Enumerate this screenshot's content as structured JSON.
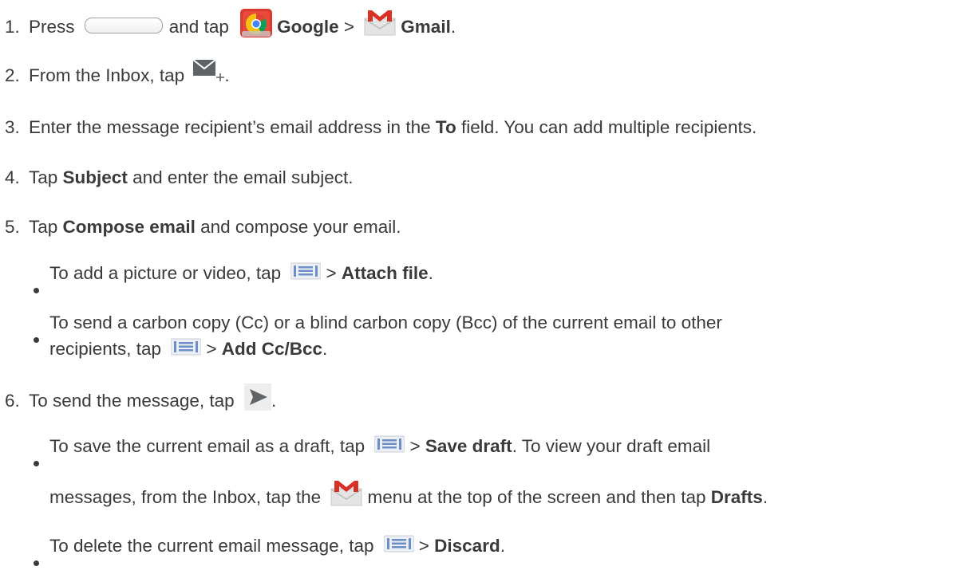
{
  "steps": [
    {
      "num": "1.",
      "t1": "Press",
      "t2": "and tap",
      "google": "Google",
      "sep": ">",
      "gmail": "Gmail",
      "end": "."
    },
    {
      "num": "2.",
      "t1": "From the Inbox, tap",
      "end": "."
    },
    {
      "num": "3.",
      "t1": "Enter the message recipient’s email address in the",
      "bold": "To",
      "t2": "field. You can add multiple recipients."
    },
    {
      "num": "4.",
      "t1": "Tap",
      "bold": "Subject",
      "t2": "and enter the email subject."
    },
    {
      "num": "5.",
      "t1": "Tap",
      "bold": "Compose email",
      "t2": "and compose your email."
    },
    {
      "num": "6.",
      "t1": "To send the message, tap",
      "end": "."
    }
  ],
  "bullets": {
    "attach": {
      "t1": "To add a picture or video, tap",
      "sep": ">",
      "bold": "Attach file",
      "end": "."
    },
    "cc_line1": "To send a carbon copy (Cc) or a blind carbon copy (Bcc) of the current email to other",
    "cc_line2": {
      "t1": "recipients, tap",
      "sep": ">",
      "bold": "Add Cc/Bcc",
      "end": "."
    },
    "save_line1": {
      "t1": "To save the current email as a draft, tap",
      "sep": ">",
      "bold": "Save draft",
      "t2": ". To view your draft email"
    },
    "save_line2": {
      "t1": "messages, from the Inbox, tap the",
      "t2": "menu at the top of the screen and then tap",
      "bold": "Drafts",
      "end": "."
    },
    "discard": {
      "t1": "To delete the current email message, tap",
      "sep": ">",
      "bold": "Discard",
      "end": "."
    }
  },
  "icons": [
    "home-button",
    "google-folder-icon",
    "gmail-icon",
    "compose-icon",
    "menu-icon",
    "send-icon"
  ]
}
